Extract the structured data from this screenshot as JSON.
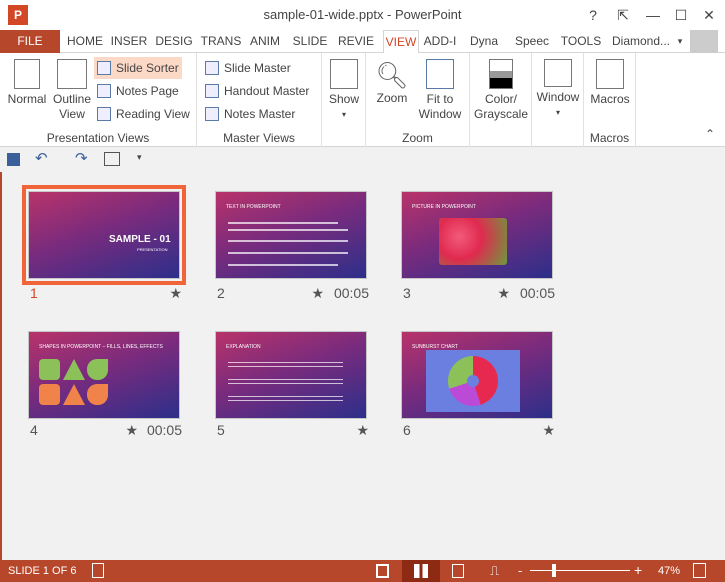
{
  "window": {
    "title": "sample-01-wide.pptx - PowerPoint",
    "app_icon": "P",
    "help": "?",
    "restore_ribbon": "⇱",
    "minimize": "—",
    "maximize": "☐",
    "close": "✕"
  },
  "tabs": [
    {
      "label": "FILE"
    },
    {
      "label": "HOME"
    },
    {
      "label": "INSER"
    },
    {
      "label": "DESIG"
    },
    {
      "label": "TRANS"
    },
    {
      "label": "ANIM"
    },
    {
      "label": "SLIDE"
    },
    {
      "label": "REVIE"
    },
    {
      "label": "VIEW",
      "active": true
    },
    {
      "label": "ADD-I"
    },
    {
      "label": "Dyna"
    },
    {
      "label": "Speec"
    },
    {
      "label": "TOOLS"
    }
  ],
  "account": {
    "name": "Diamond...",
    "caret": "▾"
  },
  "ribbon": {
    "presentation_views": {
      "label": "Presentation Views",
      "normal": "Normal",
      "outline_view": "Outline View",
      "slide_sorter": "Slide Sorter",
      "notes_page": "Notes Page",
      "reading_view": "Reading View"
    },
    "master_views": {
      "label": "Master Views",
      "slide_master": "Slide Master",
      "handout_master": "Handout Master",
      "notes_master": "Notes Master"
    },
    "show": {
      "label": "Show"
    },
    "zoom": {
      "label": "Zoom",
      "zoom": "Zoom",
      "fit_to_window": "Fit to Window"
    },
    "color": {
      "label": "Color/ Grayscale"
    },
    "window": {
      "label": "Window"
    },
    "macros": {
      "label": "Macros",
      "button": "Macros"
    },
    "collapse": "⌃"
  },
  "slides": [
    {
      "number": "1",
      "title": "SAMPLE - 01",
      "subtitle": "PRESENTATION",
      "timing": "",
      "selected": true
    },
    {
      "number": "2",
      "title": "TEXT IN POWERPOINT",
      "timing": "00:05"
    },
    {
      "number": "3",
      "title": "PICTURE IN POWERPOINT",
      "timing": "00:05"
    },
    {
      "number": "4",
      "title": "SHAPES IN POWERPOINT – FILLS, LINES, EFFECTS",
      "timing": "00:05"
    },
    {
      "number": "5",
      "title": "EXPLANATION",
      "timing": ""
    },
    {
      "number": "6",
      "title": "SUNBURST CHART",
      "timing": ""
    }
  ],
  "star": "★",
  "status": {
    "slide": "SLIDE 1 OF 6",
    "zoom": "47%",
    "zoom_fraction": 0.47,
    "minus": "-",
    "plus": "+"
  },
  "colors": {
    "accent": "#b7472a",
    "selection": "#f0643a"
  }
}
